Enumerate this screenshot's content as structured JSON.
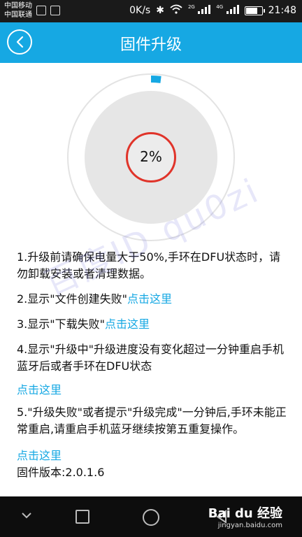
{
  "status_bar": {
    "carrier_1": "中国移动",
    "carrier_2": "中国联通",
    "network_speed": "0K/s",
    "signal_tag_1": "2G",
    "signal_tag_2": "4G",
    "time": "21:48"
  },
  "header": {
    "title": "固件升级",
    "back_icon": "chevron-left-icon"
  },
  "progress": {
    "value": 0.02,
    "label": "2%",
    "accent_color": "#16a8e3",
    "ring_color": "#e0342a"
  },
  "instructions": {
    "item1": "1.升级前请确保电量大于50%,手环在DFU状态时，请勿卸载安装或者清理数据。",
    "item2_text": "2.显示\"文件创建失败\"",
    "item2_link": "点击这里",
    "item3_text": "3.显示\"下载失败\"",
    "item3_link": "点击这里",
    "item4_text": "4.显示\"升级中\"升级进度没有变化超过一分钟重启手机蓝牙后或者手环在DFU状态",
    "item4_link": "点击这里",
    "item5_text": "5.\"升级失败\"或者提示\"升级完成\"一分钟后,手环未能正常重启,请重启手机蓝牙继续按第五重复操作。",
    "item5_link": "点击这里",
    "firmware_version": "固件版本:2.0.1.6"
  },
  "watermark": "百度ID qu0zi",
  "baidu": {
    "logo": "Bai du 经验",
    "url": "jingyan.baidu.com"
  }
}
